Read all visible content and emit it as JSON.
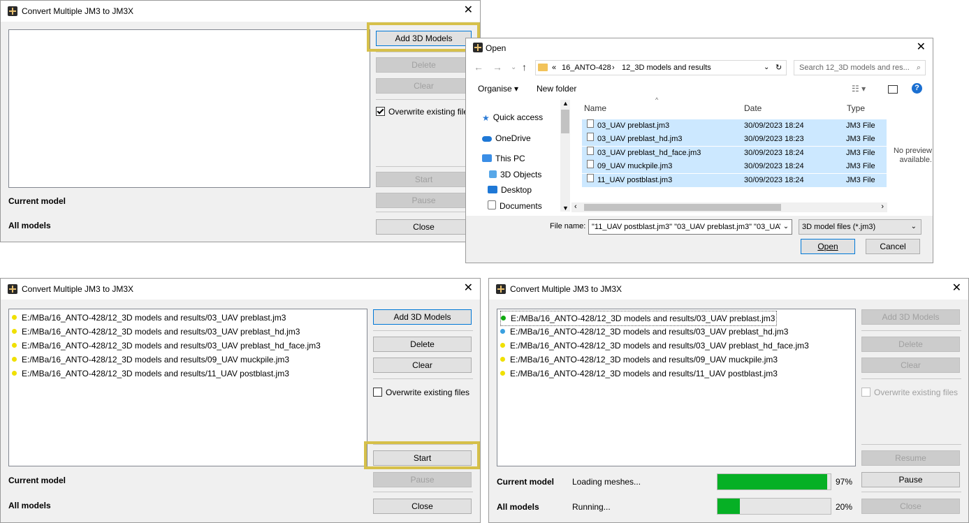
{
  "app_title": "Convert Multiple JM3 to JM3X",
  "close_glyph": "✕",
  "buttons": {
    "add": "Add 3D Models",
    "delete": "Delete",
    "clear": "Clear",
    "start": "Start",
    "pause": "Pause",
    "resume": "Resume",
    "close": "Close"
  },
  "overwrite_label": "Overwrite existing files",
  "labels": {
    "current_model": "Current model",
    "all_models": "All models"
  },
  "files": [
    "E:/MBa/16_ANTO-428/12_3D models and results/03_UAV preblast.jm3",
    "E:/MBa/16_ANTO-428/12_3D models and results/03_UAV preblast_hd.jm3",
    "E:/MBa/16_ANTO-428/12_3D models and results/03_UAV preblast_hd_face.jm3",
    "E:/MBa/16_ANTO-428/12_3D models and results/09_UAV muckpile.jm3",
    "E:/MBa/16_ANTO-428/12_3D models and results/11_UAV postblast.jm3"
  ],
  "colors": {
    "pending": "#f0e000",
    "done": "#11aa11",
    "active": "#3aa0e0",
    "progress": "#06b025",
    "highlight": "#d6c04a"
  },
  "progress": {
    "current_status": "Loading meshes...",
    "current_percent": "97%",
    "current_value": 0.97,
    "all_status": "Running...",
    "all_percent": "20%",
    "all_value": 0.2
  },
  "open_dialog": {
    "title": "Open",
    "path": [
      "«",
      "16_ANTO-428",
      "›",
      "12_3D models and results"
    ],
    "search_placeholder": "Search 12_3D models and res...",
    "organise": "Organise ▾",
    "new_folder": "New folder",
    "nav": [
      "Quick access",
      "OneDrive",
      "This PC",
      "3D Objects",
      "Desktop",
      "Documents"
    ],
    "columns": {
      "name": "Name",
      "date": "Date",
      "type": "Type"
    },
    "rows": [
      {
        "name": "03_UAV preblast.jm3",
        "date": "30/09/2023 18:24",
        "type": "JM3 File"
      },
      {
        "name": "03_UAV preblast_hd.jm3",
        "date": "30/09/2023 18:23",
        "type": "JM3 File"
      },
      {
        "name": "03_UAV preblast_hd_face.jm3",
        "date": "30/09/2023 18:24",
        "type": "JM3 File"
      },
      {
        "name": "09_UAV muckpile.jm3",
        "date": "30/09/2023 18:24",
        "type": "JM3 File"
      },
      {
        "name": "11_UAV postblast.jm3",
        "date": "30/09/2023 18:24",
        "type": "JM3 File"
      }
    ],
    "no_preview": "No preview available.",
    "file_name_label": "File name:",
    "file_name_value": "\"11_UAV postblast.jm3\" \"03_UAV preblast.jm3\" \"03_UAV",
    "filter": "3D model files (*.jm3)",
    "open_button": "Open",
    "cancel_button": "Cancel"
  }
}
